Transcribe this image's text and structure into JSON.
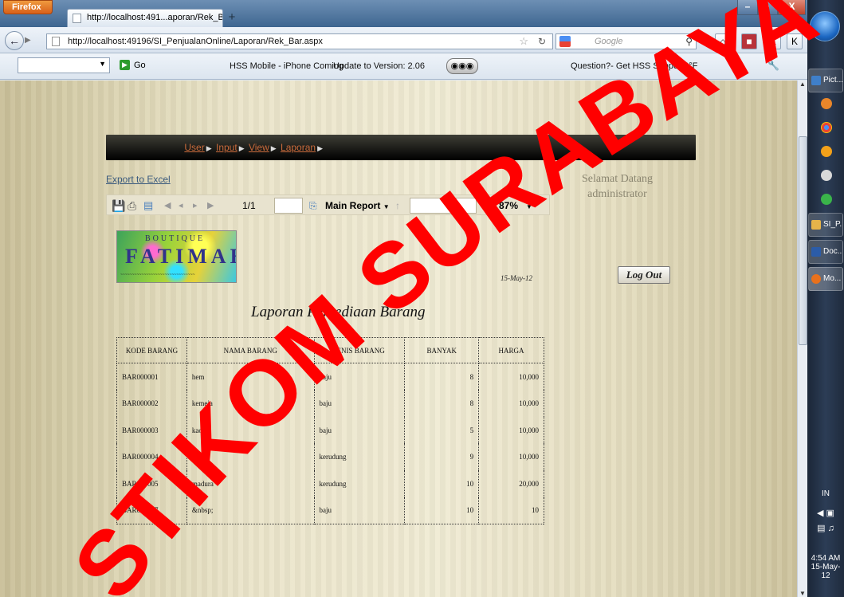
{
  "browser": {
    "app_button": "Firefox",
    "tab_title": "http://localhost:491...aporan/Rek_Bar.aspx",
    "new_tab": "+",
    "url": "http://localhost:49196/SI_PenjualanOnline/Laporan/Rek_Bar.aspx",
    "search_placeholder": "Google",
    "window_controls": [
      "–",
      "▫",
      "X"
    ]
  },
  "toolbar": {
    "go_label": "Go",
    "ad_text": "HSS Mobile - iPhone Coming",
    "update_text": "Update to Version: 2.06",
    "support_text": "Question?- Get HSS Support",
    "weather": "52°F"
  },
  "page": {
    "menu": [
      "User",
      "Input",
      "View",
      "Laporan"
    ],
    "export_link": "Export to Excel",
    "welcome_line1": "Selamat Datang",
    "welcome_line2": "administrator",
    "logout_button": "Log Out"
  },
  "report_toolbar": {
    "page_indicator": "1/1",
    "report_select": "Main Report",
    "zoom": "87%"
  },
  "report": {
    "logo_top": "BOUTIQUE",
    "logo_main": "FATIMAH",
    "date": "15-May-12",
    "title": "Laporan Persediaan Barang",
    "columns": [
      "KODE BARANG",
      "NAMA BARANG",
      "JENIS BARANG",
      "BANYAK",
      "HARGA"
    ],
    "rows": [
      [
        "BAR000001",
        "hem",
        "baju",
        "8",
        "10,000"
      ],
      [
        "BAR000002",
        "kemeja",
        "baju",
        "8",
        "10,000"
      ],
      [
        "BAR000003",
        "kaos",
        "baju",
        "5",
        "10,000"
      ],
      [
        "BAR000004",
        "rajut",
        "kerudung",
        "9",
        "10,000"
      ],
      [
        "BAR000005",
        "madura",
        "kerudung",
        "10",
        "20,000"
      ],
      [
        "BAR000007",
        "&nbsp;",
        "baju",
        "10",
        "10"
      ]
    ]
  },
  "taskbar": {
    "items": [
      "Pict...",
      "SI_P...",
      "Doc...",
      "Mo..."
    ],
    "lang": "IN",
    "time": "4:54 AM",
    "date": "15-May-12"
  },
  "watermark": {
    "text": "STIKOM SURABAYA",
    "color": "#ff0000"
  }
}
